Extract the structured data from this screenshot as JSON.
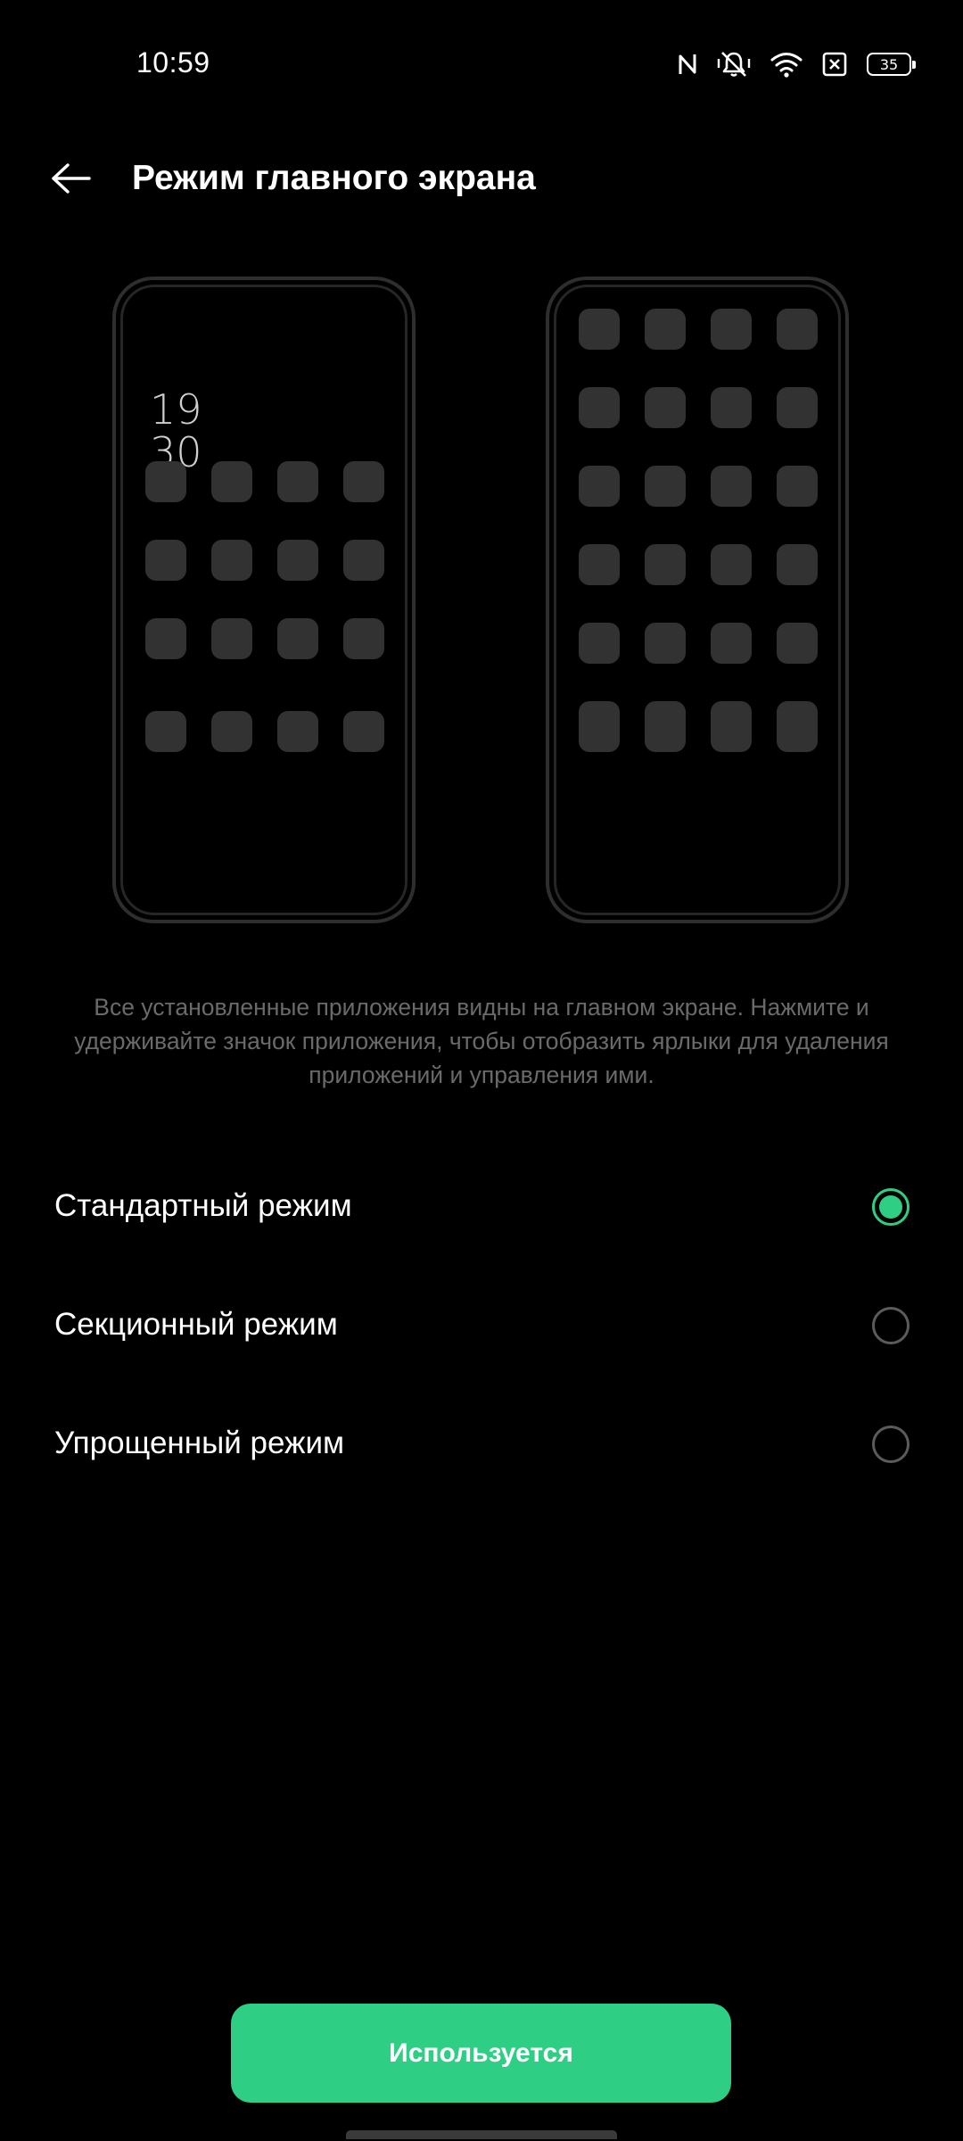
{
  "status_bar": {
    "time": "10:59",
    "icons": [
      "nfc-icon",
      "silent-icon",
      "wifi-icon",
      "sim-disabled-icon",
      "battery-icon"
    ],
    "battery_level": "35"
  },
  "header": {
    "back_icon": "arrow-left-icon",
    "title": "Режим главного экрана"
  },
  "preview": {
    "clock_hours": "19",
    "clock_minutes": "30"
  },
  "description": "Все установленные приложения видны на главном экране. Нажмите и удерживайте значок приложения, чтобы отобразить ярлыки для удаления приложений и управления ими.",
  "options": [
    {
      "label": "Стандартный режим",
      "selected": true
    },
    {
      "label": "Секционный режим",
      "selected": false
    },
    {
      "label": "Упрощенный режим",
      "selected": false
    }
  ],
  "apply_button": {
    "label": "Используется"
  },
  "colors": {
    "accent": "#2ecf84",
    "background": "#000000",
    "description_text": "#6a6a6a",
    "app_placeholder": "#323232"
  }
}
